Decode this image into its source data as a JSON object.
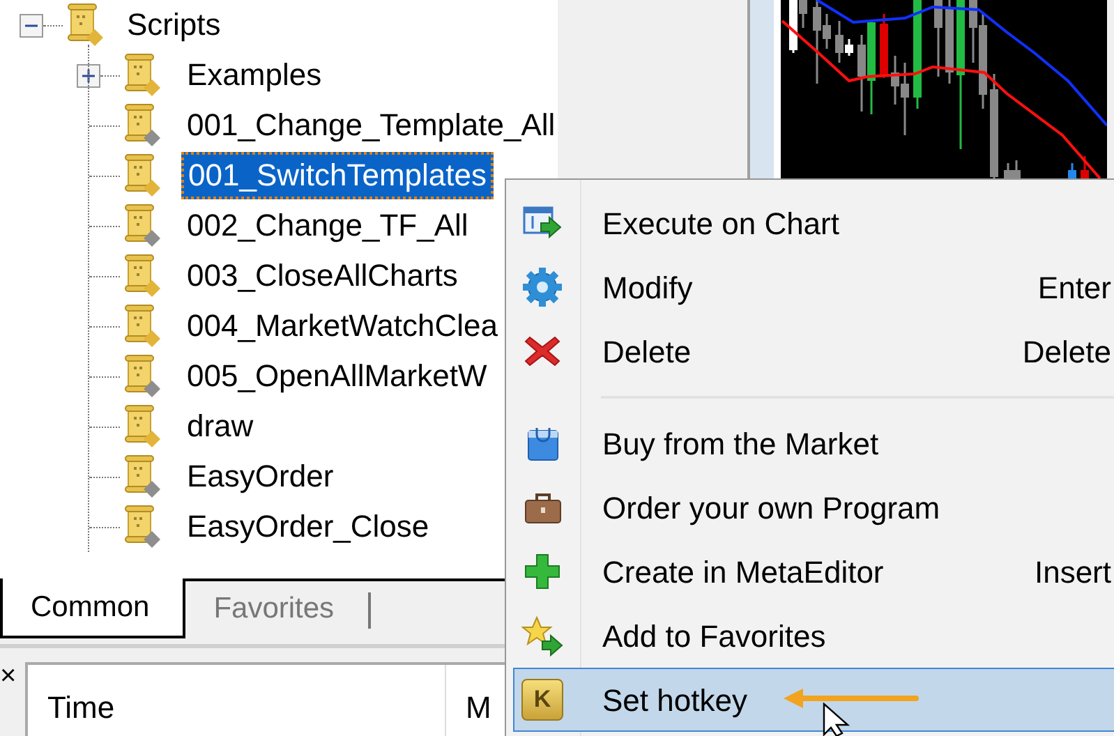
{
  "navigator": {
    "tree": {
      "label": "Scripts",
      "expanded": true,
      "color": "#e2b43a",
      "selected": false,
      "children": [
        {
          "label": "Examples",
          "expanded": false,
          "color": "#e2b43a",
          "selected": false
        },
        {
          "label": "001_Change_Template_All",
          "color": "#8e8e8e",
          "selected": false
        },
        {
          "label": "001_SwitchTemplates",
          "color": "#e2b43a",
          "selected": true
        },
        {
          "label": "002_Change_TF_All",
          "color": "#8e8e8e",
          "selected": false
        },
        {
          "label": "003_CloseAllCharts",
          "color": "#e2b43a",
          "selected": false
        },
        {
          "label": "004_MarketWatchClea",
          "color": "#e2b43a",
          "selected": false
        },
        {
          "label": "005_OpenAllMarketW",
          "color": "#8e8e8e",
          "selected": false
        },
        {
          "label": "draw",
          "color": "#e2b43a",
          "selected": false
        },
        {
          "label": "EasyOrder",
          "color": "#8e8e8e",
          "selected": false
        },
        {
          "label": "EasyOrder_Close",
          "color": "#8e8e8e",
          "selected": false
        }
      ]
    },
    "tabs": [
      {
        "label": "Common",
        "selected": true
      },
      {
        "label": "Favorites",
        "selected": false
      }
    ]
  },
  "toolbox": {
    "close": "×",
    "columns": [
      "Time",
      "M"
    ]
  },
  "context_menu": {
    "items": [
      {
        "kind": "item",
        "label": "Execute on Chart",
        "selected": false
      },
      {
        "kind": "item",
        "label": "Modify",
        "shortcut": "Enter",
        "selected": false
      },
      {
        "kind": "item",
        "label": "Delete",
        "shortcut": "Delete",
        "selected": false
      },
      {
        "kind": "separator"
      },
      {
        "kind": "item",
        "label": "Buy from the Market",
        "selected": false
      },
      {
        "kind": "item",
        "label": "Order your own Program",
        "selected": false
      },
      {
        "kind": "item",
        "label": "Create in MetaEditor",
        "shortcut": "Insert",
        "selected": false
      },
      {
        "kind": "item",
        "label": "Add to Favorites",
        "selected": false
      },
      {
        "kind": "item",
        "label": "Set hotkey",
        "selected": true,
        "icon_text": "K"
      }
    ]
  }
}
